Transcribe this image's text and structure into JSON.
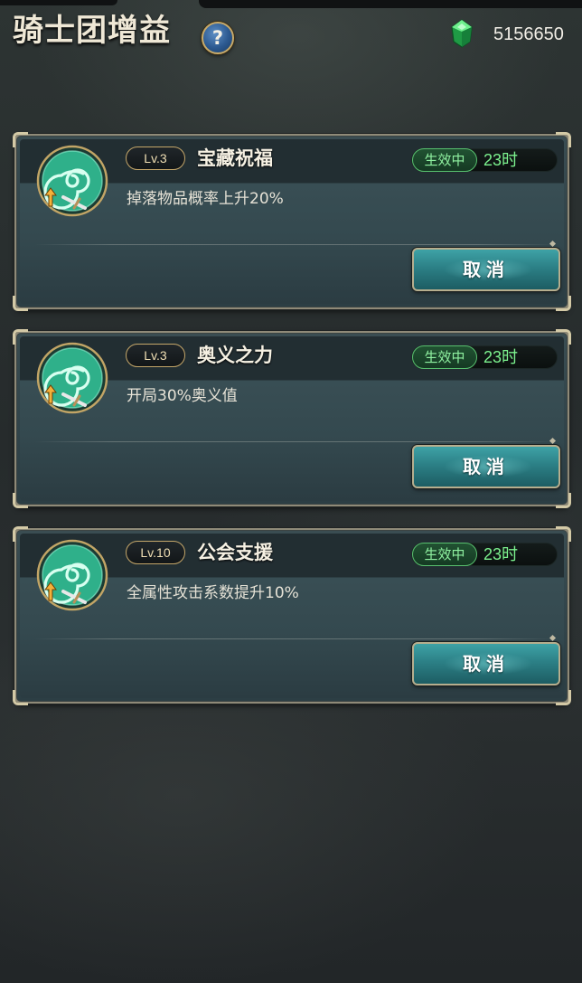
{
  "header": {
    "title": "骑士团增益",
    "help_label": "?",
    "currency_icon": "green-gem-icon",
    "currency_value": "5156650"
  },
  "buffs": [
    {
      "icon": "swirl-buff-icon",
      "level": "Lv.3",
      "name": "宝藏祝福",
      "status": "生效中",
      "time_left": "23时",
      "description": "掉落物品概率上升20%",
      "button_label": "取消"
    },
    {
      "icon": "swirl-buff-icon",
      "level": "Lv.3",
      "name": "奥义之力",
      "status": "生效中",
      "time_left": "23时",
      "description": "开局30%奥义值",
      "button_label": "取消"
    },
    {
      "icon": "swirl-buff-icon",
      "level": "Lv.10",
      "name": "公会支援",
      "status": "生效中",
      "time_left": "23时",
      "description": "全属性攻击系数提升10%",
      "button_label": "取消"
    }
  ],
  "colors": {
    "accent_gold": "#c4a669",
    "status_green": "#7cf28e",
    "button_teal": "#2c8086"
  }
}
